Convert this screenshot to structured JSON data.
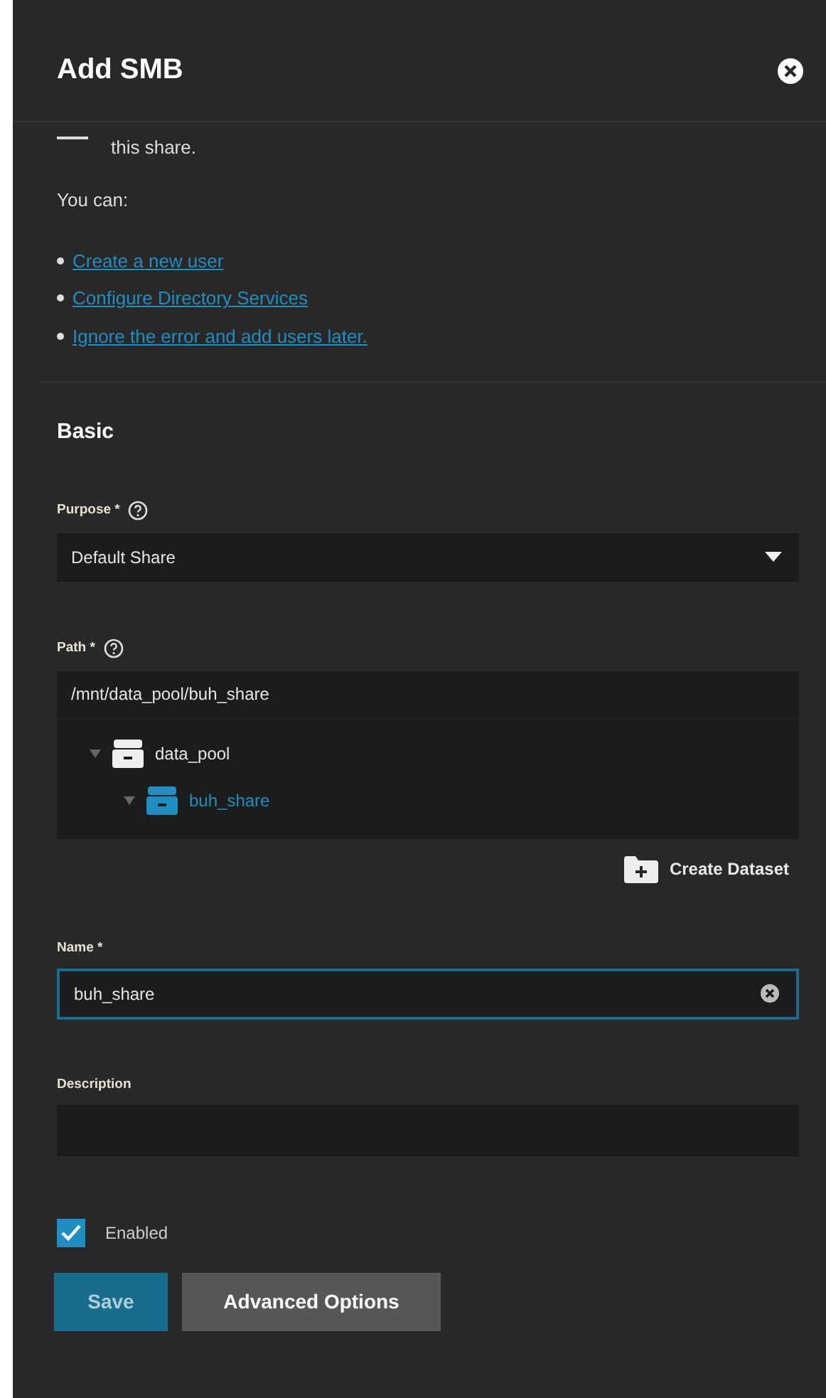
{
  "dialog": {
    "title": "Add SMB"
  },
  "message": {
    "cut_line": "this share.",
    "intro": "You can:",
    "links": [
      "Create a new user",
      "Configure Directory Services",
      "Ignore the error and add users later."
    ]
  },
  "section": {
    "title": "Basic"
  },
  "purpose": {
    "label": "Purpose *",
    "value": "Default Share"
  },
  "path": {
    "label": "Path *",
    "value": "/mnt/data_pool/buh_share",
    "tree": [
      {
        "label": "data_pool",
        "expanded": true,
        "selected": false,
        "children": [
          {
            "label": "buh_share",
            "expanded": true,
            "selected": true
          }
        ]
      }
    ],
    "create_button": "Create Dataset"
  },
  "name": {
    "label": "Name *",
    "value": "buh_share",
    "focused": true
  },
  "description": {
    "label": "Description"
  },
  "enabled": {
    "label": "Enabled",
    "checked": true
  },
  "buttons": [
    {
      "label": "Save",
      "kind": "primary",
      "disabled": true
    },
    {
      "label": "Advanced Options",
      "kind": "secondary",
      "disabled": false
    }
  ]
}
